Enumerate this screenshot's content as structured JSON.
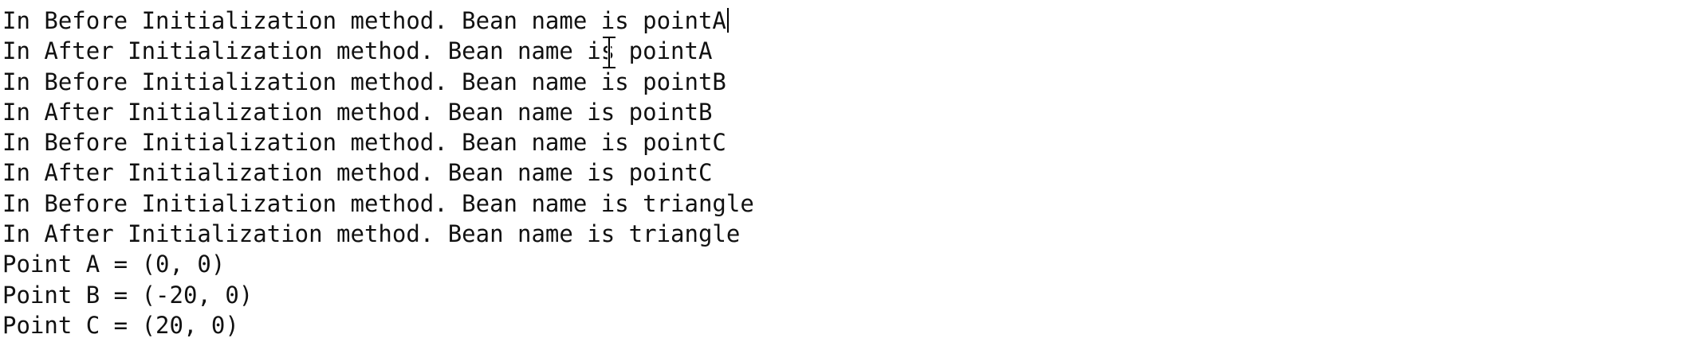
{
  "console": {
    "lines": [
      "In Before Initialization method. Bean name is pointA",
      "In After Initialization method. Bean name is pointA",
      "In Before Initialization method. Bean name is pointB",
      "In After Initialization method. Bean name is pointB",
      "In Before Initialization method. Bean name is pointC",
      "In After Initialization method. Bean name is pointC",
      "In Before Initialization method. Bean name is triangle",
      "In After Initialization method. Bean name is triangle",
      "Point A = (0, 0)",
      "Point B = (-20, 0)",
      "Point C = (20, 0)"
    ]
  },
  "colors": {
    "background": "#ffffff",
    "stdout_text": "#111111",
    "stderr_text": "#c62828"
  },
  "icons": {
    "cursor": "i-beam-cursor-icon",
    "caret": "text-caret"
  }
}
